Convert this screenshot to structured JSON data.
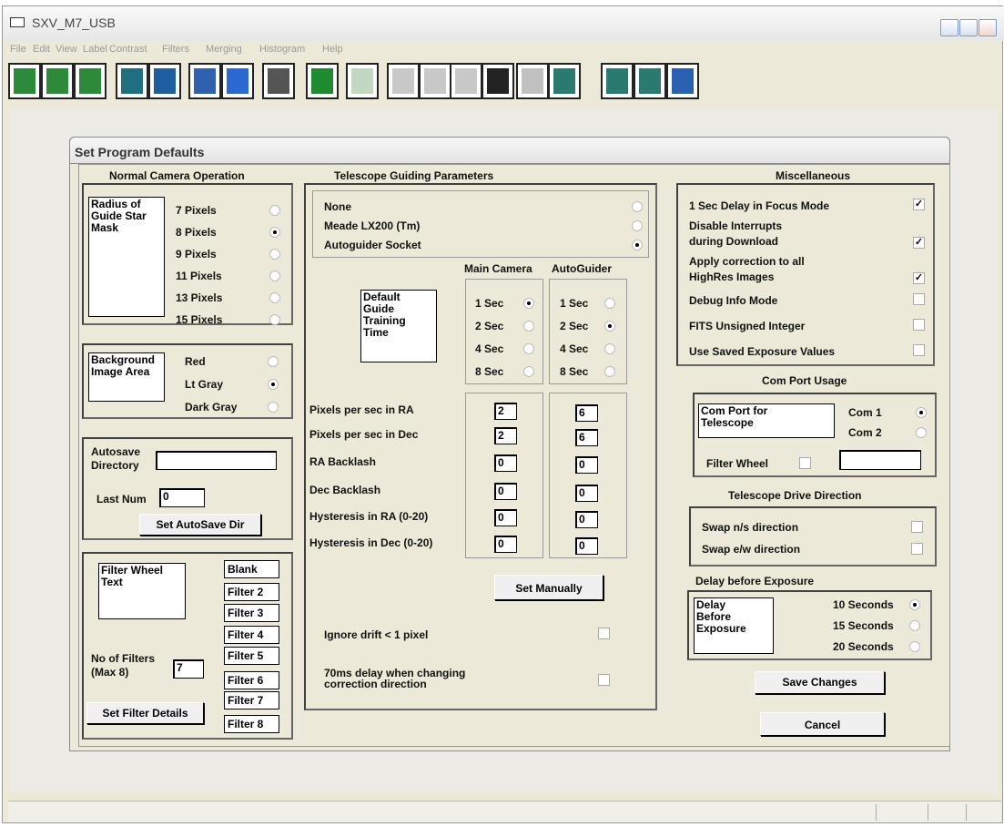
{
  "window": {
    "title": "SXV_M7_USB"
  },
  "menu": [
    "File",
    "Edit",
    "View",
    "Label",
    "Contrast",
    "Filters",
    "Merging",
    "Histogram",
    "Help"
  ],
  "toolbar_icons": [
    "open-camera-icon",
    "fits-camera-icon",
    "camera-icon",
    "guide-camera-icon",
    "telescope-icon",
    "import-icon",
    "export-icon",
    "text-view-icon",
    "info-icon",
    "stretch-icon",
    "curve-icon",
    "linear-icon",
    "histogram-icon",
    "circle-icon",
    "peak-icon",
    "dark-subtract-icon",
    "flat-multiply-icon",
    "add-merge-icon",
    "satellite-icon"
  ],
  "dialog": {
    "title": "Set Program Defaults"
  },
  "camera": {
    "heading": "Normal Camera Operation",
    "radius_label": "Radius of\nGuide Star\nMask",
    "radius_options": [
      {
        "label": "7 Pixels",
        "checked": false
      },
      {
        "label": "8 Pixels",
        "checked": true
      },
      {
        "label": "9 Pixels",
        "checked": false
      },
      {
        "label": "11 Pixels",
        "checked": false
      },
      {
        "label": "13 Pixels",
        "checked": false
      },
      {
        "label": "15 Pixels",
        "checked": false
      }
    ],
    "bg_label": "Background\nImage Area",
    "bg_options": [
      {
        "label": "Red",
        "checked": false
      },
      {
        "label": "Lt Gray",
        "checked": true
      },
      {
        "label": "Dark Gray",
        "checked": false
      }
    ],
    "autosave_label": "Autosave\nDirectory",
    "autosave_value": "",
    "lastnum_label": "Last Num",
    "lastnum_value": "0",
    "set_autosave": "Set AutoSave Dir",
    "filterwheel_text_label": "Filter Wheel\nText",
    "filters": [
      "Blank",
      "Filter 2",
      "Filter 3",
      "Filter 4",
      "Filter 5",
      "Filter 6",
      "Filter 7",
      "Filter 8"
    ],
    "num_filters_label": "No of Filters\n(Max 8)",
    "num_filters_value": "7",
    "set_filter_details": "Set Filter Details"
  },
  "telescope": {
    "heading": "Telescope Guiding Parameters",
    "modes": [
      {
        "label": "None",
        "checked": false
      },
      {
        "label": "Meade LX200 (Tm)",
        "checked": false
      },
      {
        "label": "Autoguider Socket",
        "checked": true
      }
    ],
    "main_camera": "Main Camera",
    "autoguider": "AutoGuider",
    "training_label": "Default\nGuide\nTraining\nTime",
    "main_times": [
      {
        "label": "1 Sec",
        "checked": true
      },
      {
        "label": "2 Sec",
        "checked": false
      },
      {
        "label": "4 Sec",
        "checked": false
      },
      {
        "label": "8 Sec",
        "checked": false
      }
    ],
    "ag_times": [
      {
        "label": "1 Sec",
        "checked": false
      },
      {
        "label": "2 Sec",
        "checked": true
      },
      {
        "label": "4 Sec",
        "checked": false
      },
      {
        "label": "8 Sec",
        "checked": false
      }
    ],
    "params": [
      {
        "label": "Pixels per sec in RA",
        "main": "2",
        "ag": "6"
      },
      {
        "label": "Pixels per sec in Dec",
        "main": "2",
        "ag": "6"
      },
      {
        "label": "RA Backlash",
        "main": "0",
        "ag": "0"
      },
      {
        "label": "Dec Backlash",
        "main": "0",
        "ag": "0"
      },
      {
        "label": "Hysteresis in RA (0-20)",
        "main": "0",
        "ag": "0"
      },
      {
        "label": "Hysteresis in Dec (0-20)",
        "main": "0",
        "ag": "0"
      }
    ],
    "set_manually": "Set Manually",
    "ignore_drift": "Ignore drift < 1 pixel",
    "delay_change": "70ms delay when changing\ncorrection direction"
  },
  "misc": {
    "heading": "Miscellaneous",
    "items": [
      {
        "label": "1 Sec Delay in Focus Mode",
        "checked": true
      },
      {
        "label": "Disable Interrupts\nduring Download",
        "checked": true
      },
      {
        "label": "Apply correction to all\nHighRes Images",
        "checked": true
      },
      {
        "label": "Debug Info Mode",
        "checked": false
      },
      {
        "label": "FITS Unsigned Integer",
        "checked": false
      },
      {
        "label": "Use Saved Exposure Values",
        "checked": false
      }
    ]
  },
  "comport": {
    "heading": "Com Port Usage",
    "label": "Com Port for\nTelescope",
    "options": [
      {
        "label": "Com 1",
        "checked": true
      },
      {
        "label": "Com 2",
        "checked": false
      }
    ],
    "filter_wheel": "Filter Wheel",
    "filter_wheel_value": ""
  },
  "drive": {
    "heading": "Telescope Drive Direction",
    "items": [
      {
        "label": "Swap n/s direction",
        "checked": false
      },
      {
        "label": "Swap e/w direction",
        "checked": false
      }
    ]
  },
  "exposure": {
    "heading": "Delay before Exposure",
    "label": "Delay\nBefore\nExposure",
    "options": [
      {
        "label": "10 Seconds",
        "checked": true
      },
      {
        "label": "15 Seconds",
        "checked": false
      },
      {
        "label": "20 Seconds",
        "checked": false
      }
    ]
  },
  "buttons": {
    "save": "Save Changes",
    "cancel": "Cancel"
  }
}
